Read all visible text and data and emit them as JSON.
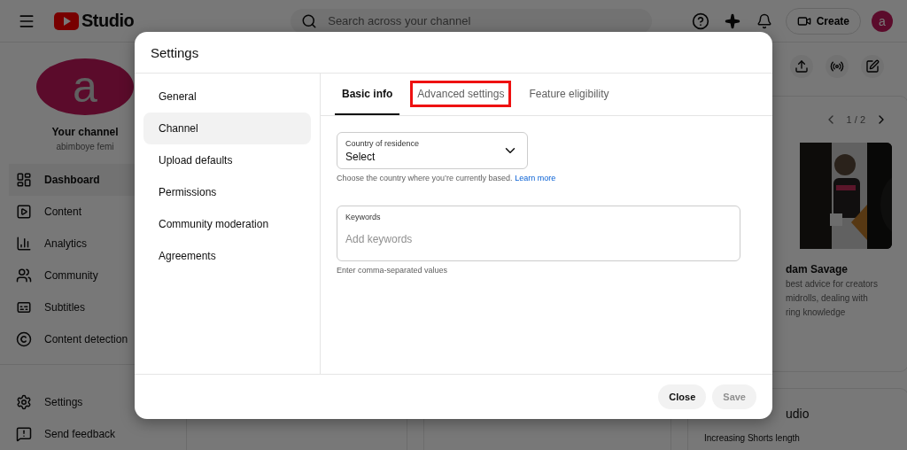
{
  "topbar": {
    "logo_text": "Studio",
    "search": {
      "placeholder": "Search across your channel"
    },
    "create_label": "Create",
    "avatar_letter": "a"
  },
  "sidebar": {
    "avatar_letter": "a",
    "channel_title": "Your channel",
    "channel_name": "abimboye femi",
    "items": [
      {
        "label": "Dashboard",
        "selected": true
      },
      {
        "label": "Content",
        "selected": false
      },
      {
        "label": "Analytics",
        "selected": false
      },
      {
        "label": "Community",
        "selected": false
      },
      {
        "label": "Subtitles",
        "selected": false
      },
      {
        "label": "Content detection",
        "selected": false
      }
    ],
    "footer_items": [
      {
        "label": "Settings",
        "selected": false
      },
      {
        "label": "Send feedback",
        "selected": false
      }
    ]
  },
  "news_card": {
    "pager": "1 / 2",
    "title": "dam Savage",
    "description_lines": [
      "best advice for creators",
      "midrolls, dealing with",
      "ring knowledge"
    ]
  },
  "second_card": {
    "title": "udio",
    "text": "Increasing Shorts length"
  },
  "dialog": {
    "title": "Settings",
    "nav": [
      {
        "label": "General",
        "selected": false
      },
      {
        "label": "Channel",
        "selected": true
      },
      {
        "label": "Upload defaults",
        "selected": false
      },
      {
        "label": "Permissions",
        "selected": false
      },
      {
        "label": "Community moderation",
        "selected": false
      },
      {
        "label": "Agreements",
        "selected": false
      }
    ],
    "tabs": [
      {
        "label": "Basic info",
        "selected": true,
        "highlighted": false
      },
      {
        "label": "Advanced settings",
        "selected": false,
        "highlighted": true
      },
      {
        "label": "Feature eligibility",
        "selected": false,
        "highlighted": false
      }
    ],
    "country": {
      "label": "Country of residence",
      "value": "Select",
      "helper": "Choose the country where you’re currently based.",
      "link": "Learn more"
    },
    "keywords": {
      "label": "Keywords",
      "placeholder": "Add keywords",
      "helper": "Enter comma-separated values"
    },
    "buttons": [
      {
        "label": "Close",
        "disabled": false
      },
      {
        "label": "Save",
        "disabled": true
      }
    ]
  }
}
